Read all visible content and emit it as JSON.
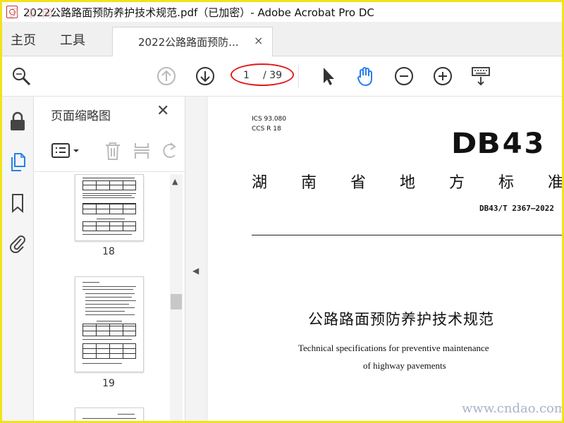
{
  "window": {
    "title": "2022公路路面预防养护技术规范.pdf（已加密）- Adobe Acrobat Pro DC"
  },
  "nav": {
    "home": "主页",
    "tools": "工具",
    "doc_tab": "2022公路路面预防...",
    "close_glyph": "×"
  },
  "toolbar": {
    "current_page": "1",
    "total_pages": "/ 39",
    "icons": [
      "zoom-search-icon",
      "page-up-icon",
      "page-down-icon",
      "select-cursor-icon",
      "hand-icon",
      "zoom-out-icon",
      "zoom-in-icon",
      "keyboard-scroll-icon"
    ]
  },
  "left_rail": {
    "icons": [
      "lock-icon",
      "page-thumbnails-icon",
      "bookmark-icon",
      "attachment-icon"
    ],
    "active_color": "#2680eb"
  },
  "thumbnails_panel": {
    "title": "页面缩略图",
    "close_glyph": "✕",
    "pages": [
      {
        "number": "18"
      },
      {
        "number": "19"
      }
    ]
  },
  "document": {
    "ics": "ICS 93.080",
    "ccs": "CCS R 18",
    "logo_db": "DB",
    "logo_num": "43",
    "province_chars": [
      "湖",
      "南",
      "省",
      "地",
      "方",
      "标",
      "准"
    ],
    "standard_code": "DB43/T 2367—2022",
    "title_cn": "公路路面预防养护技术规范",
    "title_en_line1": "Technical specifications for preventive maintenance",
    "title_en_line2": "of highway pavements"
  },
  "watermarks": {
    "top_left": "迅 漆 网",
    "bottom_right": "www.cndao.com"
  },
  "colors": {
    "frame": "#f2e21a",
    "annotation_ellipse": "#e11c1c",
    "accent_blue": "#2680eb"
  }
}
